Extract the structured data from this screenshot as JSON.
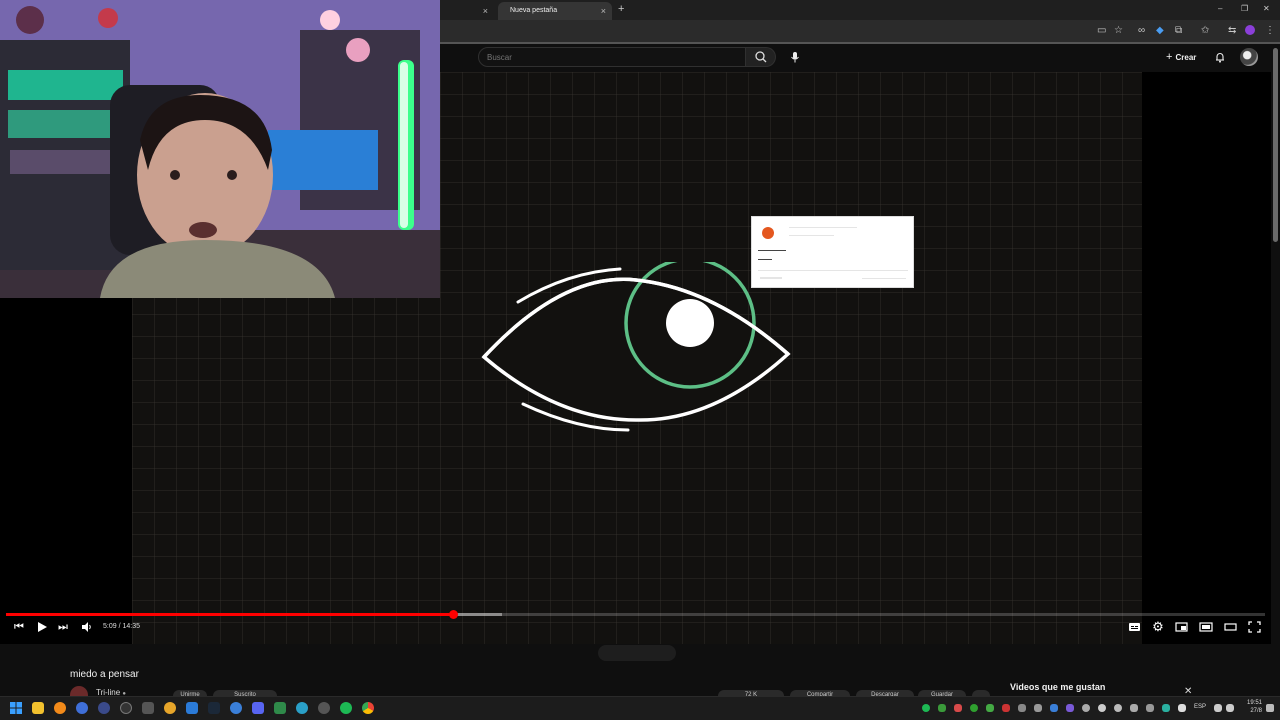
{
  "browser": {
    "tabs": [
      {
        "label": ""
      },
      {
        "label": "Nueva pestaña"
      }
    ],
    "new_tab": "+",
    "window_controls": {
      "minimize": "–",
      "maximize": "❐",
      "close": "✕"
    }
  },
  "header": {
    "search_placeholder": "Buscar",
    "create_label": "Crear"
  },
  "player": {
    "time": "5:09 / 14:35",
    "progress_fraction": 0.355
  },
  "video": {
    "title": "miedo a pensar",
    "channel": "Tri-line",
    "actions": [
      "Unirme",
      "Suscrito",
      "72 K",
      "Compartir",
      "Descargar",
      "Guardar"
    ]
  },
  "sidebar": {
    "playlist_title": "Videos que me gustan"
  },
  "taskbar": {
    "lang": "ESP",
    "time": "19:51",
    "date": "27/8"
  },
  "colors": {
    "accent_red": "#ff0000",
    "eye_green": "#5dbf86",
    "notif_orange": "#e4571f"
  }
}
